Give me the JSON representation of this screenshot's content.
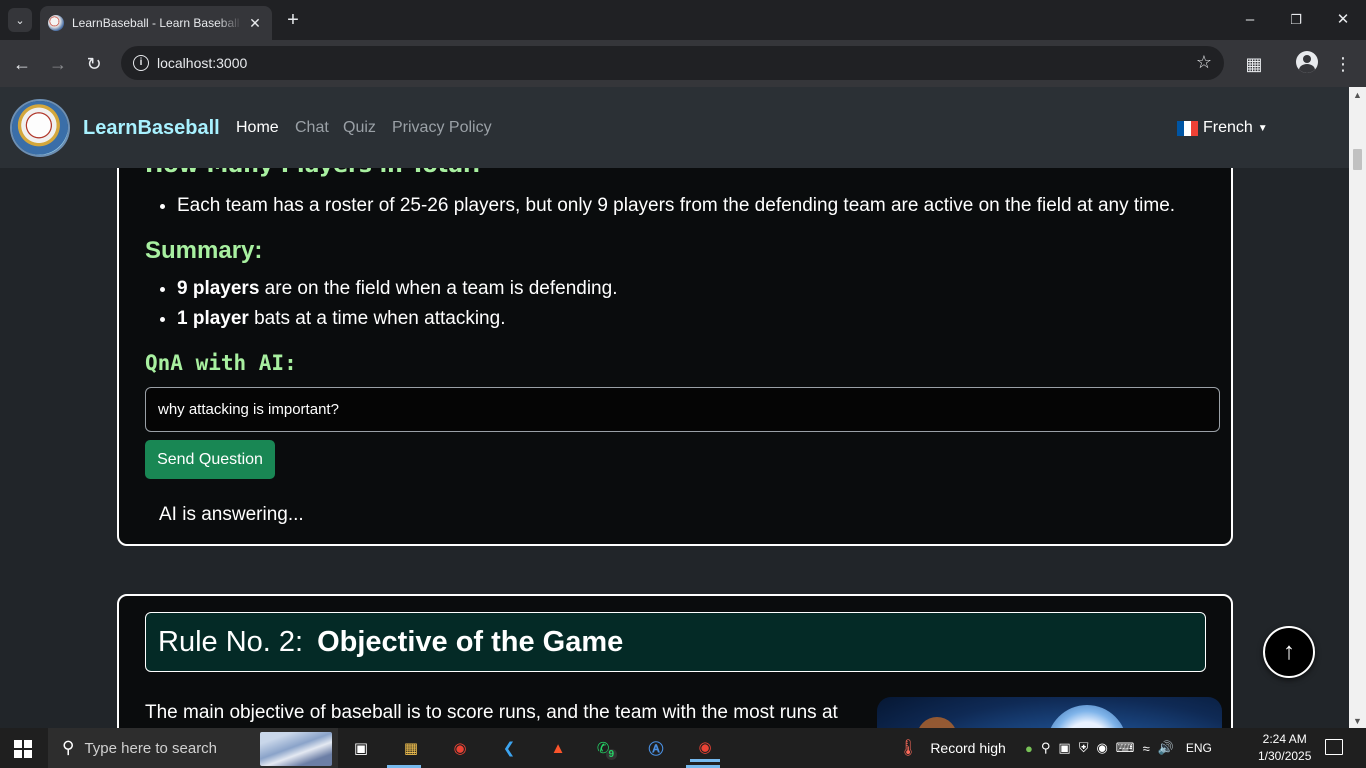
{
  "browser": {
    "tab_title": "LearnBaseball - Learn Baseball Rules",
    "url": "localhost:3000",
    "new_tab": "+",
    "minimize": "–",
    "restore": "❐",
    "close": "✕"
  },
  "navbar": {
    "brand": "LearnBaseball",
    "links": [
      "Home",
      "Chat",
      "Quiz",
      "Privacy Policy"
    ],
    "active_link": "Home",
    "language": "French",
    "flag_colors": [
      "#0055a4",
      "#ffffff",
      "#ef4135"
    ]
  },
  "rule1": {
    "heading_cut": "How Many Players in Total?",
    "total_items": [
      "Each team has a roster of 25-26 players, but only 9 players from the defending team are active on the field at any time."
    ],
    "summary_heading": "Summary:",
    "summary_items": [
      {
        "bold": "9 players",
        "text": " are on the field when a team is defending."
      },
      {
        "bold": "1 player",
        "text": " bats at a time when attacking."
      }
    ],
    "qna_heading": "QnA with AI:",
    "question_value": "why attacking is important?",
    "send_label": "Send Question",
    "ai_status": "AI is answering..."
  },
  "rule2": {
    "number": "Rule No. 2:",
    "title": "Objective of the Game",
    "paragraph": "The main objective of baseball is to score runs, and the team with the most runs at"
  },
  "scroll_top": "↑",
  "taskbar": {
    "search_placeholder": "Type here to search",
    "whatsapp_badge": "9",
    "weather": "Record high",
    "language": "ENG",
    "time": "2:24 AM",
    "date": "1/30/2025"
  },
  "colors": {
    "heading_green": "#a8f0a0",
    "brand_cyan": "#a8f1ff",
    "button_green": "#198754",
    "rule_box_bg": "#042a26"
  }
}
